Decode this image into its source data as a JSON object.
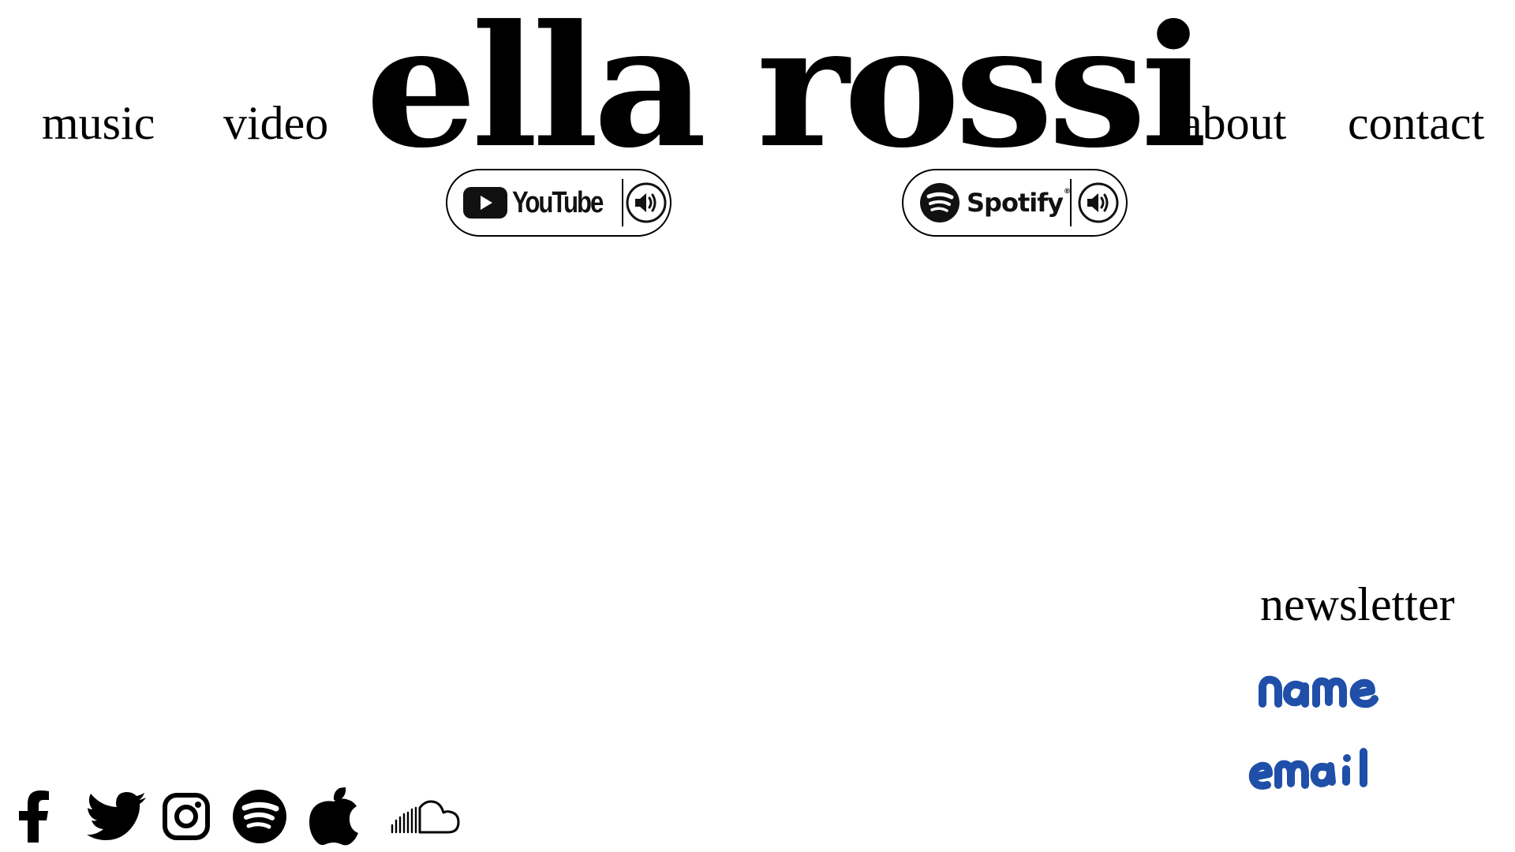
{
  "header": {
    "brand": "ella rossi",
    "nav": {
      "music": "music",
      "video": "video",
      "about": "about",
      "contact": "contact"
    }
  },
  "listen_buttons": [
    {
      "service": "YouTube",
      "icon": "youtube-logo-icon",
      "action_icon": "speaker-icon"
    },
    {
      "service": "Spotify",
      "icon": "spotify-logo-icon",
      "action_icon": "speaker-icon"
    }
  ],
  "newsletter": {
    "title": "newsletter",
    "name_placeholder": "name",
    "email_placeholder": "email",
    "handwriting_color": "#1f4fa8"
  },
  "social_links": [
    {
      "network": "facebook",
      "icon": "facebook-icon"
    },
    {
      "network": "twitter",
      "icon": "twitter-icon"
    },
    {
      "network": "instagram",
      "icon": "instagram-icon"
    },
    {
      "network": "spotify",
      "icon": "spotify-icon"
    },
    {
      "network": "apple music",
      "icon": "apple-icon"
    },
    {
      "network": "soundcloud",
      "icon": "soundcloud-icon"
    }
  ],
  "colors": {
    "background": "#ffffff",
    "text": "#000000",
    "accent_handwriting": "#1f4fa8"
  }
}
